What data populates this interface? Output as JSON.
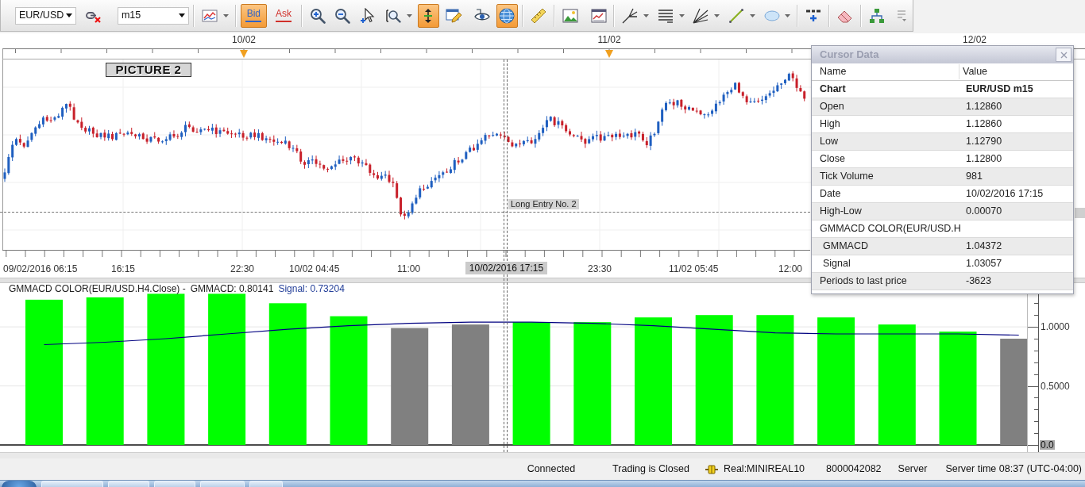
{
  "toolbar": {
    "symbol": "EUR/USD",
    "timeframe": "m15",
    "price_buttons": [
      {
        "label": "Bid",
        "selected": true,
        "color": "#2f63c8"
      },
      {
        "label": "Ask",
        "selected": false,
        "color": "#d0302a"
      }
    ],
    "tools": [
      {
        "on": false,
        "dropdown": false
      },
      {
        "on": false,
        "dropdown": true
      },
      {
        "on": false,
        "dropdown": false
      },
      {
        "on": false,
        "dropdown": false
      },
      {
        "on": false,
        "dropdown": false
      },
      {
        "on": false,
        "dropdown": true
      },
      {
        "on": true,
        "dropdown": false
      },
      {
        "on": false,
        "dropdown": false
      },
      {
        "on": false,
        "dropdown": false
      },
      {
        "on": true,
        "dropdown": false
      },
      {
        "on": false,
        "dropdown": false
      },
      {
        "on": false,
        "dropdown": false
      },
      {
        "on": false,
        "dropdown": false
      },
      {
        "on": false,
        "dropdown": true
      },
      {
        "on": false,
        "dropdown": true
      },
      {
        "on": false,
        "dropdown": true
      },
      {
        "on": false,
        "dropdown": true
      },
      {
        "on": false,
        "dropdown": true
      },
      {
        "on": false,
        "dropdown": false
      },
      {
        "on": false,
        "dropdown": false
      },
      {
        "on": false,
        "dropdown": false
      },
      {
        "on": false,
        "dropdown": false
      }
    ]
  },
  "chart": {
    "dates": [
      "10/02",
      "11/02",
      "12/02"
    ],
    "annotation": "PICTURE 2",
    "entry_label": "Long Entry No. 2",
    "time_labels": [
      "09/02/2016 06:15",
      "16:15",
      "22:30",
      "10/02 04:45",
      "11:00",
      "23:30",
      "11/02 05:45",
      "12:00"
    ],
    "cursor_time": "10/02/2016 17:15"
  },
  "indicator": {
    "title": "GMMACD COLOR(EUR/USD.H4.Close) -",
    "gmmacd_reading": "GMMACD: 0.80141",
    "signal_reading": "Signal: 0.73204",
    "baseline_label": "0.0",
    "chart_data": {
      "type": "bar",
      "stacked": true,
      "ylim": [
        -0.06,
        1.37
      ],
      "yticks": [
        {
          "value": 1,
          "label": "1.0000"
        },
        {
          "value": 0.5,
          "label": "0.5000"
        }
      ],
      "series": [
        {
          "color": "#00ff00",
          "values": [
            1.23,
            1.25,
            1.28,
            1.28,
            1.2,
            1.09,
            null,
            null,
            1.04,
            1.04,
            1.08,
            1.1,
            1.1,
            1.08,
            1.02,
            0.96,
            null
          ]
        },
        {
          "color": "#808080",
          "values": [
            null,
            null,
            null,
            null,
            null,
            null,
            0.99,
            1.02,
            null,
            null,
            null,
            null,
            null,
            null,
            null,
            null,
            0.9
          ]
        },
        {
          "type": "line",
          "color": "#000080",
          "values": [
            0.85,
            0.87,
            0.9,
            0.94,
            0.98,
            1.01,
            1.03,
            1.04,
            1.04,
            1.03,
            1.01,
            0.98,
            0.95,
            0.94,
            0.94,
            0.94,
            0.93
          ]
        }
      ]
    }
  },
  "cursor_data": {
    "title": "Cursor Data",
    "columns": [
      "Name",
      "Value"
    ],
    "rows": [
      {
        "kind": "chart",
        "name": "Chart",
        "value": "EUR/USD m15"
      },
      {
        "kind": "field",
        "name": "Open",
        "value": "1.12860"
      },
      {
        "kind": "field",
        "name": "High",
        "value": "1.12860"
      },
      {
        "kind": "field",
        "name": "Low",
        "value": "1.12790"
      },
      {
        "kind": "field",
        "name": "Close",
        "value": "1.12800"
      },
      {
        "kind": "field",
        "name": "Tick Volume",
        "value": "981"
      },
      {
        "kind": "field",
        "name": "Date",
        "value": "10/02/2016 17:15"
      },
      {
        "kind": "field",
        "name": "High-Low",
        "value": "0.00070"
      },
      {
        "kind": "group",
        "name": "GMMACD COLOR(EUR/USD.H",
        "children": [
          {
            "kind": "field",
            "name": "GMMACD",
            "value": "1.04372"
          },
          {
            "kind": "field",
            "name": "Signal",
            "value": "1.03057"
          }
        ]
      },
      {
        "kind": "field",
        "name": "Periods to last price",
        "value": "-3623"
      }
    ]
  },
  "status_bar": {
    "items": [
      "Connected",
      "Trading is Closed",
      "Real:MINIREAL10",
      "8000042082",
      "Server",
      "Server time 08:37 (UTC-04:00)"
    ]
  }
}
